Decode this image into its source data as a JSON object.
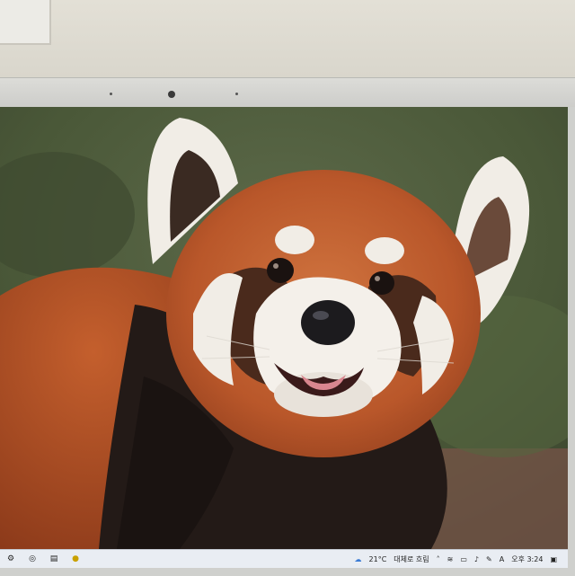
{
  "taskbar": {
    "weather_temp": "21°C",
    "weather_desc": "대체로 흐림",
    "ime_label": "A",
    "clock": "오후 3:24"
  },
  "icons": {
    "left": [
      "settings-icon",
      "browser-icon",
      "file-icon",
      "chat-icon"
    ],
    "right": [
      "weather-icon",
      "chevron-up-icon",
      "wifi-icon",
      "battery-icon",
      "speaker-icon",
      "pen-icon",
      "notification-icon"
    ]
  },
  "colors": {
    "fur_orange": "#b9572a",
    "fur_dark": "#231a17",
    "white_fur": "#f1ede6",
    "background_green": "#4f5e3f"
  }
}
